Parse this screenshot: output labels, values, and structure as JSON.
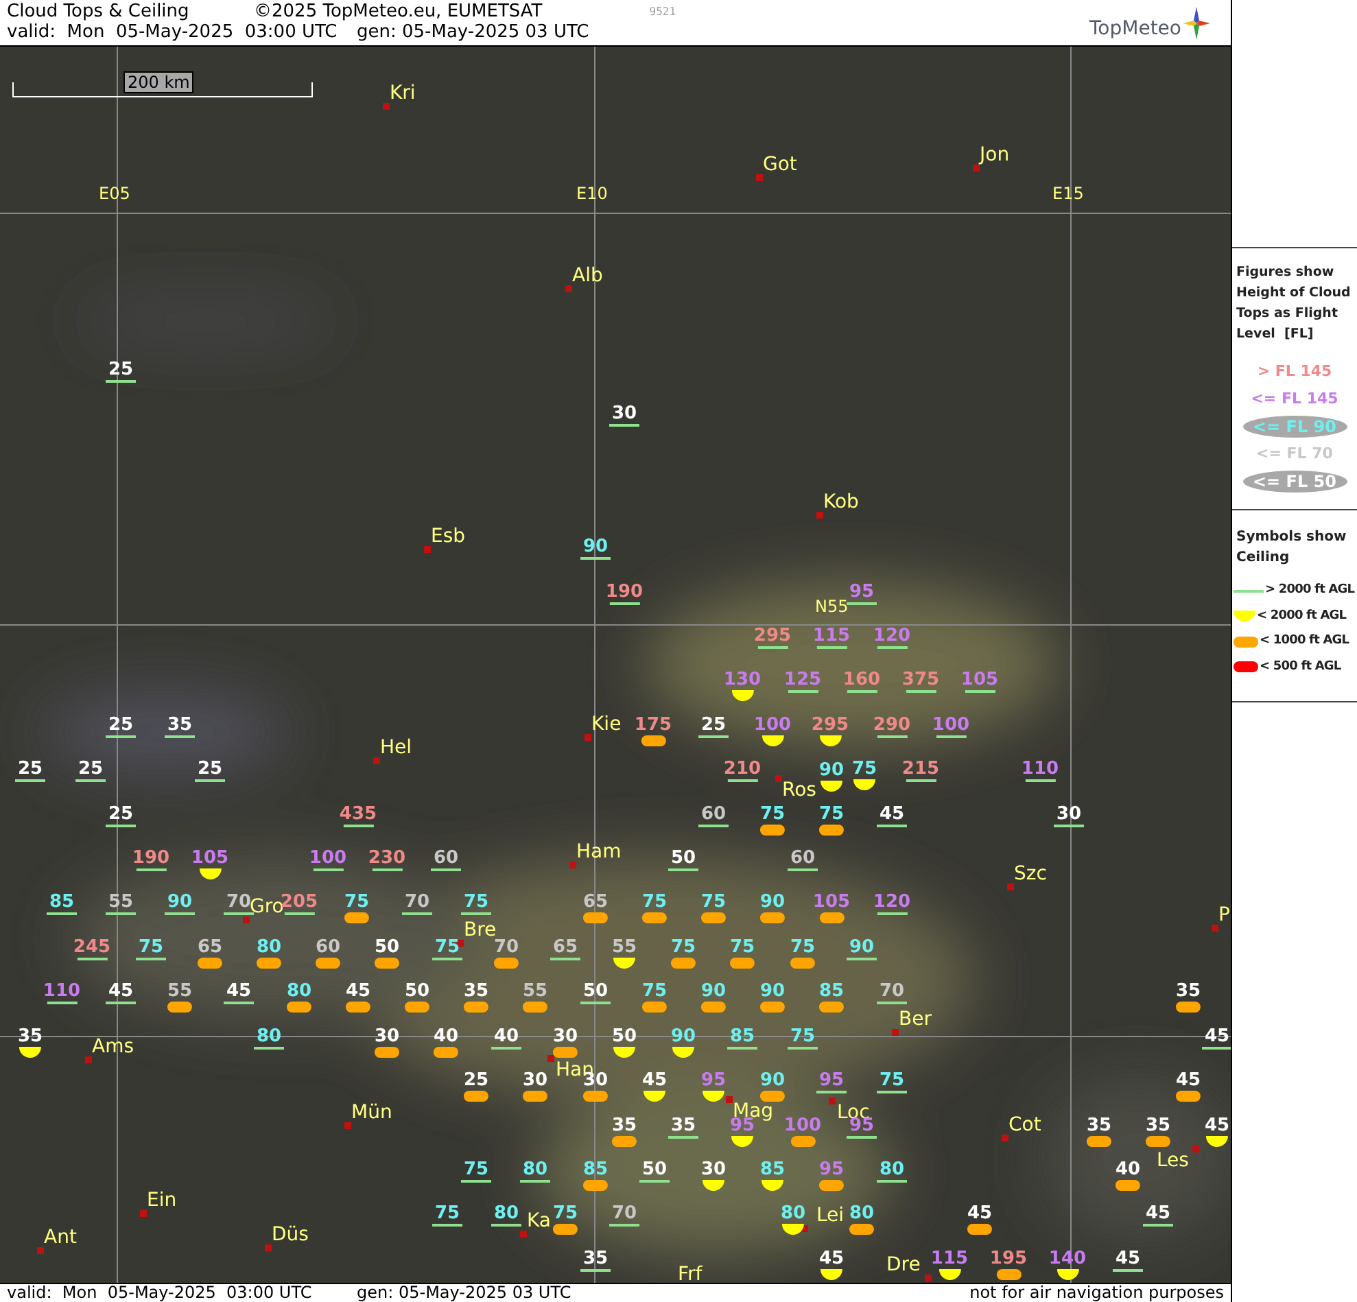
{
  "header": {
    "title": "Cloud Tops & Ceiling",
    "copyright": "©2025 TopMeteo.eu, EUMETSAT",
    "code": "9521",
    "valid": "valid:  Mon  05-May-2025  03:00 UTC",
    "generated": "gen: 05-May-2025 03 UTC",
    "logo": "TopMeteo"
  },
  "map": {
    "scale": "200 km",
    "grid_labels": [
      "E05",
      "E10",
      "E15",
      "N55"
    ],
    "cities": [
      "Kri",
      "Got",
      "Jon",
      "Alb",
      "Esb",
      "Kob",
      "Kie",
      "Hel",
      "Ros",
      "Ham",
      "Szc",
      "Gro",
      "Bre",
      "P",
      "Ber",
      "Ams",
      "Han",
      "Mün",
      "Mag",
      "Loc",
      "Cot",
      "Les",
      "Ein",
      "Ka",
      "Lei",
      "Düs",
      "Ant",
      "Dre",
      "Frf"
    ],
    "figures": [
      {
        "text": "25",
        "color": "#ffffff",
        "kind": "line"
      },
      {
        "text": "30",
        "color": "#ffffff",
        "kind": "line"
      },
      {
        "text": "90",
        "color": "#6ef0f0",
        "kind": "line"
      },
      {
        "text": "190",
        "color": "#f08a8a",
        "kind": "line"
      },
      {
        "text": "95",
        "color": "#c87cf0",
        "kind": "line"
      },
      {
        "text": "295",
        "color": "#f08a8a",
        "kind": "line"
      },
      {
        "text": "115",
        "color": "#c87cf0",
        "kind": "line"
      },
      {
        "text": "120",
        "color": "#c87cf0",
        "kind": "line"
      },
      {
        "text": "130",
        "color": "#c87cf0",
        "kind": "half"
      },
      {
        "text": "125",
        "color": "#c87cf0",
        "kind": "line"
      },
      {
        "text": "160",
        "color": "#f08a8a",
        "kind": "line"
      },
      {
        "text": "375",
        "color": "#f08a8a",
        "kind": "line"
      },
      {
        "text": "105",
        "color": "#c87cf0",
        "kind": "line"
      },
      {
        "text": "25",
        "color": "#ffffff",
        "kind": "line"
      },
      {
        "text": "35",
        "color": "#ffffff",
        "kind": "line"
      },
      {
        "text": "175",
        "color": "#f08a8a",
        "kind": "pill"
      },
      {
        "text": "25",
        "color": "#ffffff",
        "kind": "line"
      },
      {
        "text": "100",
        "color": "#c87cf0",
        "kind": "half"
      },
      {
        "text": "295",
        "color": "#f08a8a",
        "kind": "half"
      },
      {
        "text": "290",
        "color": "#f08a8a",
        "kind": "line"
      },
      {
        "text": "100",
        "color": "#c87cf0",
        "kind": "line"
      },
      {
        "text": "25",
        "color": "#ffffff",
        "kind": "line"
      },
      {
        "text": "25",
        "color": "#ffffff",
        "kind": "line"
      },
      {
        "text": "25",
        "color": "#ffffff",
        "kind": "line"
      },
      {
        "text": "210",
        "color": "#f08a8a",
        "kind": "line"
      },
      {
        "text": "90",
        "color": "#6ef0f0",
        "kind": "half"
      },
      {
        "text": "75",
        "color": "#6ef0f0",
        "kind": "half"
      },
      {
        "text": "215",
        "color": "#f08a8a",
        "kind": "line"
      },
      {
        "text": "110",
        "color": "#c87cf0",
        "kind": "line"
      },
      {
        "text": "25",
        "color": "#ffffff",
        "kind": "line"
      },
      {
        "text": "435",
        "color": "#f08a8a",
        "kind": "line"
      },
      {
        "text": "60",
        "color": "#c8c8c8",
        "kind": "line"
      },
      {
        "text": "75",
        "color": "#6ef0f0",
        "kind": "pill"
      },
      {
        "text": "75",
        "color": "#6ef0f0",
        "kind": "pill"
      },
      {
        "text": "45",
        "color": "#ffffff",
        "kind": "line"
      },
      {
        "text": "30",
        "color": "#ffffff",
        "kind": "line"
      },
      {
        "text": "190",
        "color": "#f08a8a",
        "kind": "line"
      },
      {
        "text": "105",
        "color": "#c87cf0",
        "kind": "half"
      },
      {
        "text": "100",
        "color": "#c87cf0",
        "kind": "line"
      },
      {
        "text": "230",
        "color": "#f08a8a",
        "kind": "line"
      },
      {
        "text": "60",
        "color": "#c8c8c8",
        "kind": "line"
      },
      {
        "text": "50",
        "color": "#ffffff",
        "kind": "line"
      },
      {
        "text": "60",
        "color": "#c8c8c8",
        "kind": "line"
      },
      {
        "text": "85",
        "color": "#6ef0f0",
        "kind": "line"
      },
      {
        "text": "55",
        "color": "#c8c8c8",
        "kind": "line"
      },
      {
        "text": "90",
        "color": "#6ef0f0",
        "kind": "line"
      },
      {
        "text": "70",
        "color": "#c8c8c8",
        "kind": "line"
      },
      {
        "text": "205",
        "color": "#f08a8a",
        "kind": "line"
      },
      {
        "text": "75",
        "color": "#6ef0f0",
        "kind": "pill"
      },
      {
        "text": "70",
        "color": "#c8c8c8",
        "kind": "line"
      },
      {
        "text": "75",
        "color": "#6ef0f0",
        "kind": "line"
      },
      {
        "text": "65",
        "color": "#c8c8c8",
        "kind": "pill"
      },
      {
        "text": "75",
        "color": "#6ef0f0",
        "kind": "pill"
      },
      {
        "text": "75",
        "color": "#6ef0f0",
        "kind": "pill"
      },
      {
        "text": "90",
        "color": "#6ef0f0",
        "kind": "pill"
      },
      {
        "text": "105",
        "color": "#c87cf0",
        "kind": "pill"
      },
      {
        "text": "120",
        "color": "#c87cf0",
        "kind": "line"
      },
      {
        "text": "245",
        "color": "#f08a8a",
        "kind": "line"
      },
      {
        "text": "75",
        "color": "#6ef0f0",
        "kind": "line"
      },
      {
        "text": "65",
        "color": "#c8c8c8",
        "kind": "pill"
      },
      {
        "text": "80",
        "color": "#6ef0f0",
        "kind": "pill"
      },
      {
        "text": "60",
        "color": "#c8c8c8",
        "kind": "pill"
      },
      {
        "text": "50",
        "color": "#ffffff",
        "kind": "pill"
      },
      {
        "text": "75",
        "color": "#6ef0f0",
        "kind": "line"
      },
      {
        "text": "70",
        "color": "#c8c8c8",
        "kind": "pill"
      },
      {
        "text": "65",
        "color": "#c8c8c8",
        "kind": "line"
      },
      {
        "text": "55",
        "color": "#c8c8c8",
        "kind": "half"
      },
      {
        "text": "75",
        "color": "#6ef0f0",
        "kind": "pill"
      },
      {
        "text": "75",
        "color": "#6ef0f0",
        "kind": "pill"
      },
      {
        "text": "75",
        "color": "#6ef0f0",
        "kind": "pill"
      },
      {
        "text": "90",
        "color": "#6ef0f0",
        "kind": "line"
      },
      {
        "text": "110",
        "color": "#c87cf0",
        "kind": "line"
      },
      {
        "text": "45",
        "color": "#ffffff",
        "kind": "line"
      },
      {
        "text": "55",
        "color": "#c8c8c8",
        "kind": "pill"
      },
      {
        "text": "45",
        "color": "#ffffff",
        "kind": "line"
      },
      {
        "text": "80",
        "color": "#6ef0f0",
        "kind": "pill"
      },
      {
        "text": "45",
        "color": "#ffffff",
        "kind": "pill"
      },
      {
        "text": "50",
        "color": "#ffffff",
        "kind": "pill"
      },
      {
        "text": "35",
        "color": "#ffffff",
        "kind": "pill"
      },
      {
        "text": "55",
        "color": "#c8c8c8",
        "kind": "pill"
      },
      {
        "text": "50",
        "color": "#ffffff",
        "kind": "line"
      },
      {
        "text": "75",
        "color": "#6ef0f0",
        "kind": "pill"
      },
      {
        "text": "90",
        "color": "#6ef0f0",
        "kind": "pill"
      },
      {
        "text": "90",
        "color": "#6ef0f0",
        "kind": "pill"
      },
      {
        "text": "85",
        "color": "#6ef0f0",
        "kind": "pill"
      },
      {
        "text": "70",
        "color": "#c8c8c8",
        "kind": "line"
      },
      {
        "text": "35",
        "color": "#ffffff",
        "kind": "pill"
      },
      {
        "text": "35",
        "color": "#ffffff",
        "kind": "half"
      },
      {
        "text": "80",
        "color": "#6ef0f0",
        "kind": "line"
      },
      {
        "text": "30",
        "color": "#ffffff",
        "kind": "pill"
      },
      {
        "text": "40",
        "color": "#ffffff",
        "kind": "pill"
      },
      {
        "text": "40",
        "color": "#ffffff",
        "kind": "line"
      },
      {
        "text": "30",
        "color": "#ffffff",
        "kind": "pill"
      },
      {
        "text": "50",
        "color": "#ffffff",
        "kind": "half"
      },
      {
        "text": "90",
        "color": "#6ef0f0",
        "kind": "half"
      },
      {
        "text": "85",
        "color": "#6ef0f0",
        "kind": "line"
      },
      {
        "text": "75",
        "color": "#6ef0f0",
        "kind": "line"
      },
      {
        "text": "45",
        "color": "#ffffff",
        "kind": "line"
      },
      {
        "text": "25",
        "color": "#ffffff",
        "kind": "pill"
      },
      {
        "text": "30",
        "color": "#ffffff",
        "kind": "pill"
      },
      {
        "text": "30",
        "color": "#ffffff",
        "kind": "pill"
      },
      {
        "text": "45",
        "color": "#ffffff",
        "kind": "half"
      },
      {
        "text": "95",
        "color": "#c87cf0",
        "kind": "half"
      },
      {
        "text": "90",
        "color": "#6ef0f0",
        "kind": "pill"
      },
      {
        "text": "95",
        "color": "#c87cf0",
        "kind": "line"
      },
      {
        "text": "75",
        "color": "#6ef0f0",
        "kind": "line"
      },
      {
        "text": "45",
        "color": "#ffffff",
        "kind": "pill"
      },
      {
        "text": "35",
        "color": "#ffffff",
        "kind": "pill"
      },
      {
        "text": "35",
        "color": "#ffffff",
        "kind": "line"
      },
      {
        "text": "95",
        "color": "#c87cf0",
        "kind": "half"
      },
      {
        "text": "100",
        "color": "#c87cf0",
        "kind": "pill"
      },
      {
        "text": "95",
        "color": "#c87cf0",
        "kind": "line"
      },
      {
        "text": "35",
        "color": "#ffffff",
        "kind": "pill"
      },
      {
        "text": "35",
        "color": "#ffffff",
        "kind": "pill"
      },
      {
        "text": "45",
        "color": "#ffffff",
        "kind": "half"
      },
      {
        "text": "75",
        "color": "#6ef0f0",
        "kind": "line"
      },
      {
        "text": "80",
        "color": "#6ef0f0",
        "kind": "line"
      },
      {
        "text": "85",
        "color": "#6ef0f0",
        "kind": "pill"
      },
      {
        "text": "50",
        "color": "#ffffff",
        "kind": "line"
      },
      {
        "text": "30",
        "color": "#ffffff",
        "kind": "half"
      },
      {
        "text": "85",
        "color": "#6ef0f0",
        "kind": "half"
      },
      {
        "text": "95",
        "color": "#c87cf0",
        "kind": "pill"
      },
      {
        "text": "80",
        "color": "#6ef0f0",
        "kind": "line"
      },
      {
        "text": "40",
        "color": "#ffffff",
        "kind": "pill"
      },
      {
        "text": "75",
        "color": "#6ef0f0",
        "kind": "line"
      },
      {
        "text": "80",
        "color": "#6ef0f0",
        "kind": "line"
      },
      {
        "text": "75",
        "color": "#6ef0f0",
        "kind": "pill"
      },
      {
        "text": "70",
        "color": "#c8c8c8",
        "kind": "line"
      },
      {
        "text": "80",
        "color": "#6ef0f0",
        "kind": "half"
      },
      {
        "text": "80",
        "color": "#6ef0f0",
        "kind": "pill"
      },
      {
        "text": "45",
        "color": "#ffffff",
        "kind": "pill"
      },
      {
        "text": "45",
        "color": "#ffffff",
        "kind": "line"
      },
      {
        "text": "35",
        "color": "#ffffff",
        "kind": "line"
      },
      {
        "text": "45",
        "color": "#ffffff",
        "kind": "half"
      },
      {
        "text": "115",
        "color": "#c87cf0",
        "kind": "half"
      },
      {
        "text": "195",
        "color": "#f08a8a",
        "kind": "pill"
      },
      {
        "text": "140",
        "color": "#c87cf0",
        "kind": "half"
      },
      {
        "text": "45",
        "color": "#ffffff",
        "kind": "line"
      }
    ]
  },
  "legend": {
    "figures_title": "Figures show Height of Cloud Tops as Flight Level  [FL]",
    "tops": [
      {
        "label": "> FL 145",
        "color": "#f08a8a",
        "kind": "plain"
      },
      {
        "label": "<= FL 145",
        "color": "#c87cf0",
        "kind": "plain"
      },
      {
        "label": "<= FL 90",
        "color": "#6ef0f0",
        "kind": "ellipse"
      },
      {
        "label": "<= FL 70",
        "color": "#c8c8c8",
        "kind": "plain"
      },
      {
        "label": "<= FL 50",
        "color": "#ffffff",
        "kind": "ellipse"
      }
    ],
    "symbols_title": "Symbols show Ceiling",
    "ceilings": [
      {
        "label": "> 2000 ft AGL",
        "kind": "line"
      },
      {
        "label": "< 2000 ft AGL",
        "kind": "half"
      },
      {
        "label": "< 1000 ft AGL",
        "kind": "pill"
      },
      {
        "label": "< 500 ft AGL",
        "kind": "dot"
      }
    ]
  },
  "footer": {
    "valid": "valid:  Mon  05-May-2025  03:00 UTC",
    "generated": "gen: 05-May-2025 03 UTC",
    "disclaimer": "not for air navigation purposes"
  }
}
